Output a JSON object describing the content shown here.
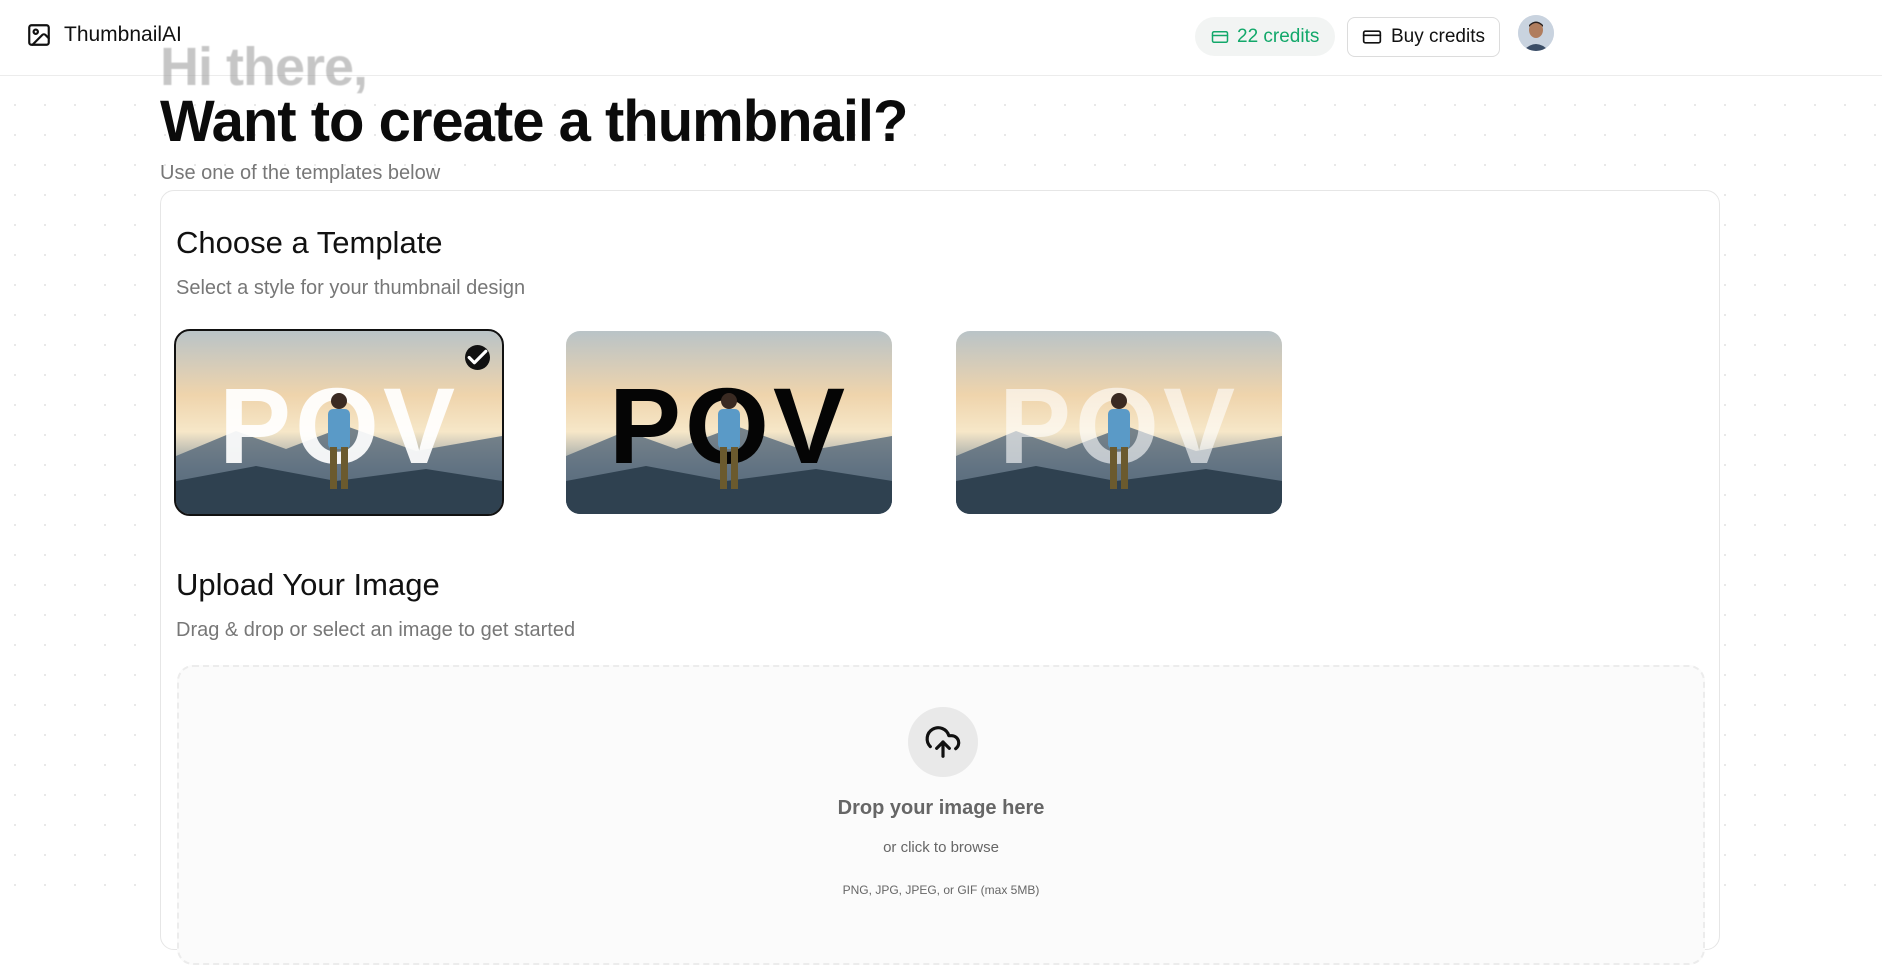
{
  "header": {
    "brand": "ThumbnailAI",
    "credits_label": "22 credits",
    "buy_label": "Buy credits"
  },
  "hero": {
    "greeting": "Hi there,",
    "headline": "Want to create a thumbnail?",
    "subline": "Use one of the templates below"
  },
  "templates": {
    "title": "Choose a Template",
    "subtitle": "Select a style for your thumbnail design",
    "items": [
      {
        "text": "POV",
        "style": "white-text",
        "selected": true
      },
      {
        "text": "POV",
        "style": "black-text",
        "selected": false
      },
      {
        "text": "POV",
        "style": "faded-white-text",
        "selected": false
      }
    ]
  },
  "upload": {
    "title": "Upload Your Image",
    "subtitle": "Drag & drop or select an image to get started",
    "drop_title": "Drop your image here",
    "drop_sub": "or click to browse",
    "drop_note": "PNG, JPG, JPEG, or GIF (max 5MB)"
  },
  "colors": {
    "accent_green": "#12a86a",
    "text_dark": "#111111",
    "muted": "#777777"
  },
  "icons": [
    "image-icon",
    "credit-card-icon",
    "check-icon",
    "cloud-upload-icon"
  ]
}
